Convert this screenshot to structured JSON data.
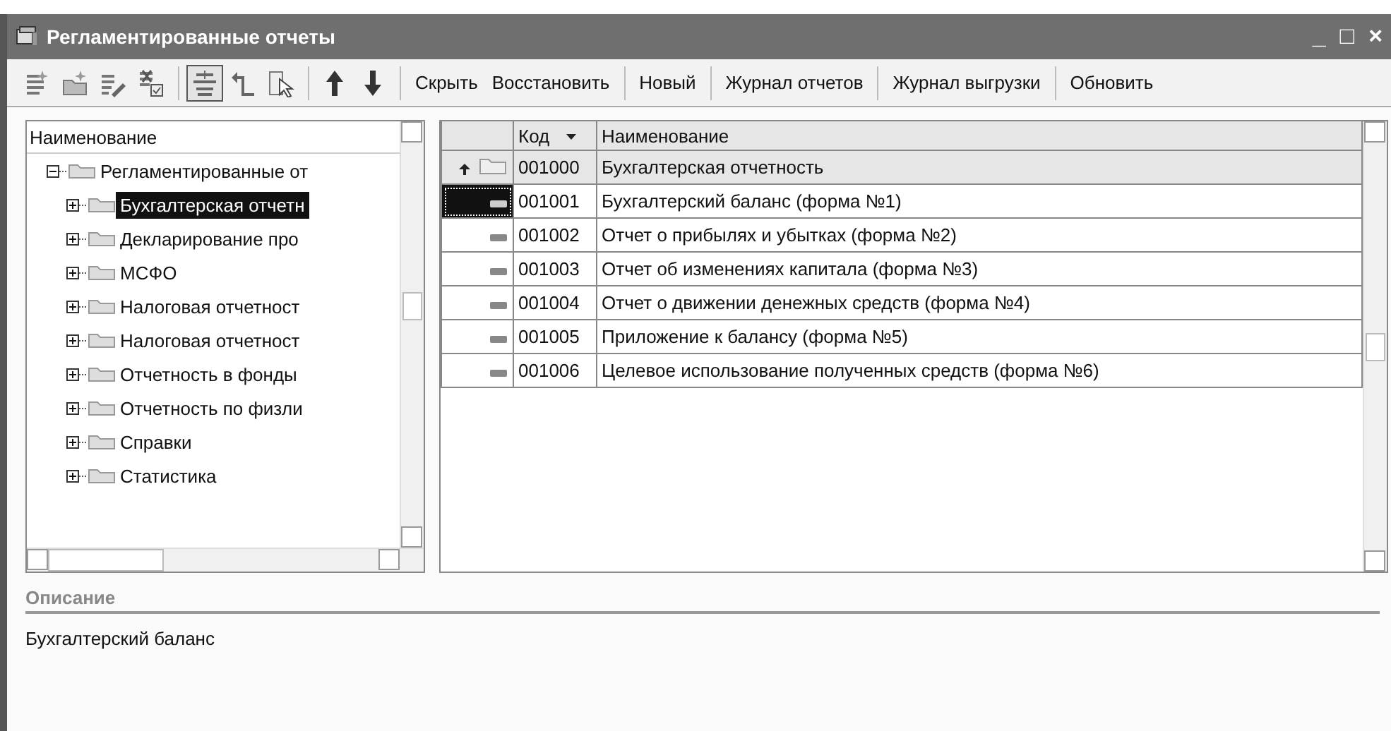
{
  "window": {
    "title": "Регламентированные отчеты",
    "controls": [
      "_",
      "□",
      "×"
    ]
  },
  "toolbar": {
    "tools": [
      {
        "kind": "add-row",
        "selected": false
      },
      {
        "kind": "add-folder",
        "selected": false
      },
      {
        "kind": "edit",
        "selected": false
      },
      {
        "kind": "mark",
        "selected": false
      },
      {
        "kind": "hierarchy",
        "selected": true
      },
      {
        "kind": "level-up",
        "selected": false
      },
      {
        "kind": "pick",
        "selected": false
      },
      {
        "kind": "move-up",
        "selected": false
      },
      {
        "kind": "move-down",
        "selected": false
      }
    ],
    "buttons": [
      "Скрыть",
      "Восстановить",
      "Новый",
      "Журнал отчетов",
      "Журнал выгрузки",
      "Обновить"
    ]
  },
  "tree": {
    "header": "Наименование",
    "items": [
      {
        "label": "Регламентированные от",
        "expanded": true,
        "selected": false,
        "children": [
          {
            "label": "Бухгалтерская отчетн",
            "expanded": false,
            "selected": true
          },
          {
            "label": "Декларирование про",
            "expanded": false,
            "selected": false
          },
          {
            "label": "МСФО",
            "expanded": false,
            "selected": false
          },
          {
            "label": "Налоговая отчетност",
            "expanded": false,
            "selected": false
          },
          {
            "label": "Налоговая отчетност",
            "expanded": false,
            "selected": false
          },
          {
            "label": "Отчетность в фонды",
            "expanded": false,
            "selected": false
          },
          {
            "label": "Отчетность по физли",
            "expanded": false,
            "selected": false
          },
          {
            "label": "Справки",
            "expanded": false,
            "selected": false
          },
          {
            "label": "Статистика",
            "expanded": false,
            "selected": false
          }
        ]
      }
    ]
  },
  "table": {
    "columns": [
      "Код",
      "Наименование"
    ],
    "rows": [
      {
        "kind": "group",
        "selected": false,
        "cells": [
          "001000",
          "Бухгалтерская отчетность"
        ]
      },
      {
        "kind": "item",
        "selected": true,
        "cells": [
          "001001",
          "Бухгалтерский баланс (форма №1)"
        ]
      },
      {
        "kind": "item",
        "selected": false,
        "cells": [
          "001002",
          "Отчет о прибылях и убытках (форма №2)"
        ]
      },
      {
        "kind": "item",
        "selected": false,
        "cells": [
          "001003",
          "Отчет об изменениях капитала (форма №3)"
        ]
      },
      {
        "kind": "item",
        "selected": false,
        "cells": [
          "001004",
          "Отчет о движении денежных средств (форма №4)"
        ]
      },
      {
        "kind": "item",
        "selected": false,
        "cells": [
          "001005",
          "Приложение к балансу (форма №5)"
        ]
      },
      {
        "kind": "item",
        "selected": false,
        "cells": [
          "001006",
          "Целевое использование полученных средств (форма №6)"
        ]
      }
    ]
  },
  "description": {
    "label": "Описание",
    "text": "Бухгалтерский баланс"
  }
}
